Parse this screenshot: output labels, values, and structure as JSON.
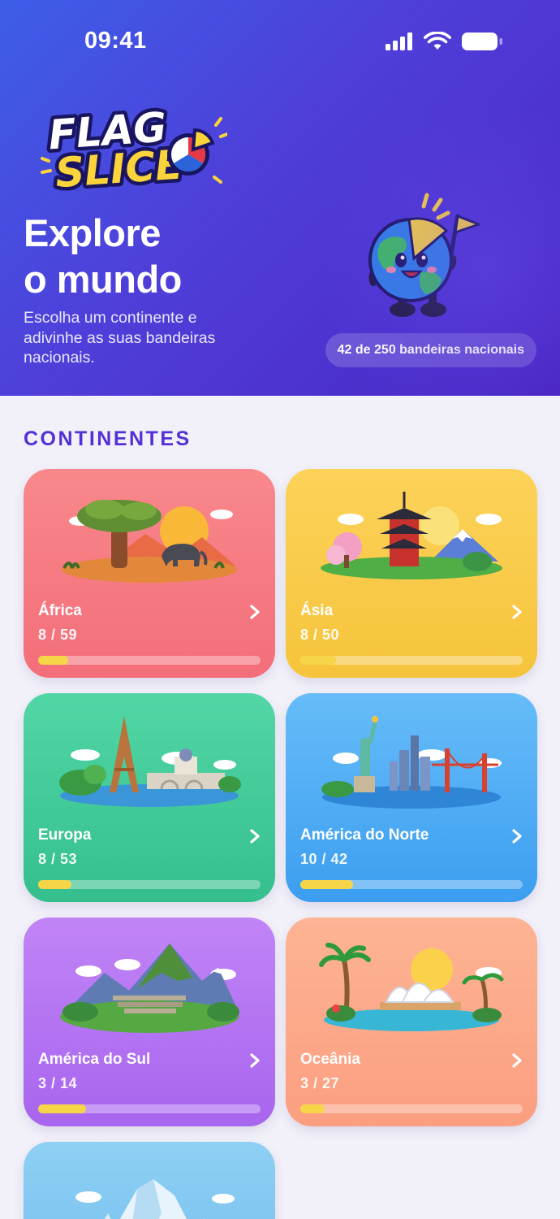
{
  "status_bar": {
    "time": "09:41"
  },
  "app": {
    "logo_line1": "FLAG",
    "logo_line2": "SLICE"
  },
  "hero": {
    "title_line1": "Explore",
    "title_line2": "o mundo",
    "subtitle": "Escolha um continente e adivinhe as suas bandeiras nacionais.",
    "progress_pill": "42 de 250 bandeiras nacionais"
  },
  "section_title": "CONTINENTES",
  "colors": {
    "accent": "#5430d6",
    "progress_fill": "#f7d548"
  },
  "continents": [
    {
      "name": "África",
      "count": "8 / 59",
      "progress": 0.136,
      "color": "#f47c82",
      "icon": "baobab-elephant-sunset"
    },
    {
      "name": "Ásia",
      "count": "8 / 50",
      "progress": 0.16,
      "color": "#f8ca47",
      "icon": "pagoda-mount-fuji"
    },
    {
      "name": "Europa",
      "count": "8 / 53",
      "progress": 0.151,
      "color": "#42c999",
      "icon": "eiffel-tower-bridge"
    },
    {
      "name": "América do Norte",
      "count": "10 / 42",
      "progress": 0.238,
      "color": "#50aef4",
      "icon": "statue-of-liberty-golden-gate"
    },
    {
      "name": "América do Sul",
      "count": "3 / 14",
      "progress": 0.214,
      "color": "#b474f2",
      "icon": "machu-picchu"
    },
    {
      "name": "Oceânia",
      "count": "3 / 27",
      "progress": 0.111,
      "color": "#fca98a",
      "icon": "sydney-opera-house-palms"
    },
    {
      "name": "",
      "count": "",
      "progress": 0,
      "color": "#85c9f2",
      "icon": "iceberg-penguins"
    }
  ]
}
